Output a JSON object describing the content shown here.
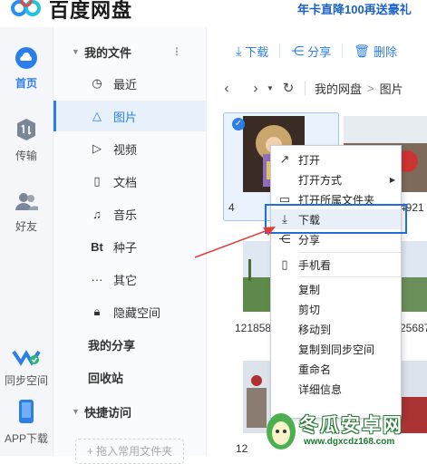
{
  "app": {
    "title": "百度网盘",
    "promo": "年卡直降100再送豪礼"
  },
  "rail": {
    "home": "首页",
    "transfer": "传输",
    "friends": "好友",
    "sync": "同步空间",
    "app": "APP下载"
  },
  "sidebar": {
    "my_files": "我的文件",
    "items": [
      {
        "label": "最近",
        "icon": "clock-icon"
      },
      {
        "label": "图片",
        "icon": "image-icon"
      },
      {
        "label": "视频",
        "icon": "play-icon"
      },
      {
        "label": "文档",
        "icon": "document-icon"
      },
      {
        "label": "音乐",
        "icon": "headphones-icon"
      },
      {
        "label": "种子",
        "icon": "bt-icon",
        "glyph": "Bt"
      },
      {
        "label": "其它",
        "icon": "more-icon",
        "glyph": "···"
      },
      {
        "label": "隐藏空间",
        "icon": "lock-icon"
      }
    ],
    "my_share": "我的分享",
    "recycle": "回收站",
    "quick_access": "快捷访问",
    "add_quick": "+ 拖入常用文件夹"
  },
  "toolbar": {
    "download": "下载",
    "share": "分享",
    "delete": "删除"
  },
  "breadcrumb": {
    "root": "我的网盘",
    "sep": ">",
    "current": "图片"
  },
  "files": {
    "names": [
      "121858",
      "25687",
      "12"
    ],
    "partial_name": "4921",
    "partial_name_left": "4"
  },
  "context_menu": {
    "items": [
      {
        "label": "打开",
        "icon": "open-arrow-icon"
      },
      {
        "label": "打开方式",
        "submenu": true
      },
      {
        "label": "打开所属文件夹",
        "icon": "folder-icon"
      },
      {
        "label": "下载",
        "icon": "download-icon",
        "highlighted": true
      },
      {
        "label": "分享",
        "icon": "share-icon"
      },
      {
        "label": "手机看",
        "icon": "phone-icon"
      },
      {
        "label": "复制"
      },
      {
        "label": "剪切"
      },
      {
        "label": "移动到"
      },
      {
        "label": "复制到同步空间"
      },
      {
        "label": "重命名"
      },
      {
        "label": "详细信息"
      }
    ]
  },
  "watermark": {
    "title": "冬瓜安卓网",
    "url": "www.dgxcdz168.com"
  },
  "colors": {
    "accent": "#2c7fe8",
    "promo": "#1c61c7",
    "annotation_box": "#1f6fd6",
    "annotation_arrow": "#e03c3c"
  }
}
